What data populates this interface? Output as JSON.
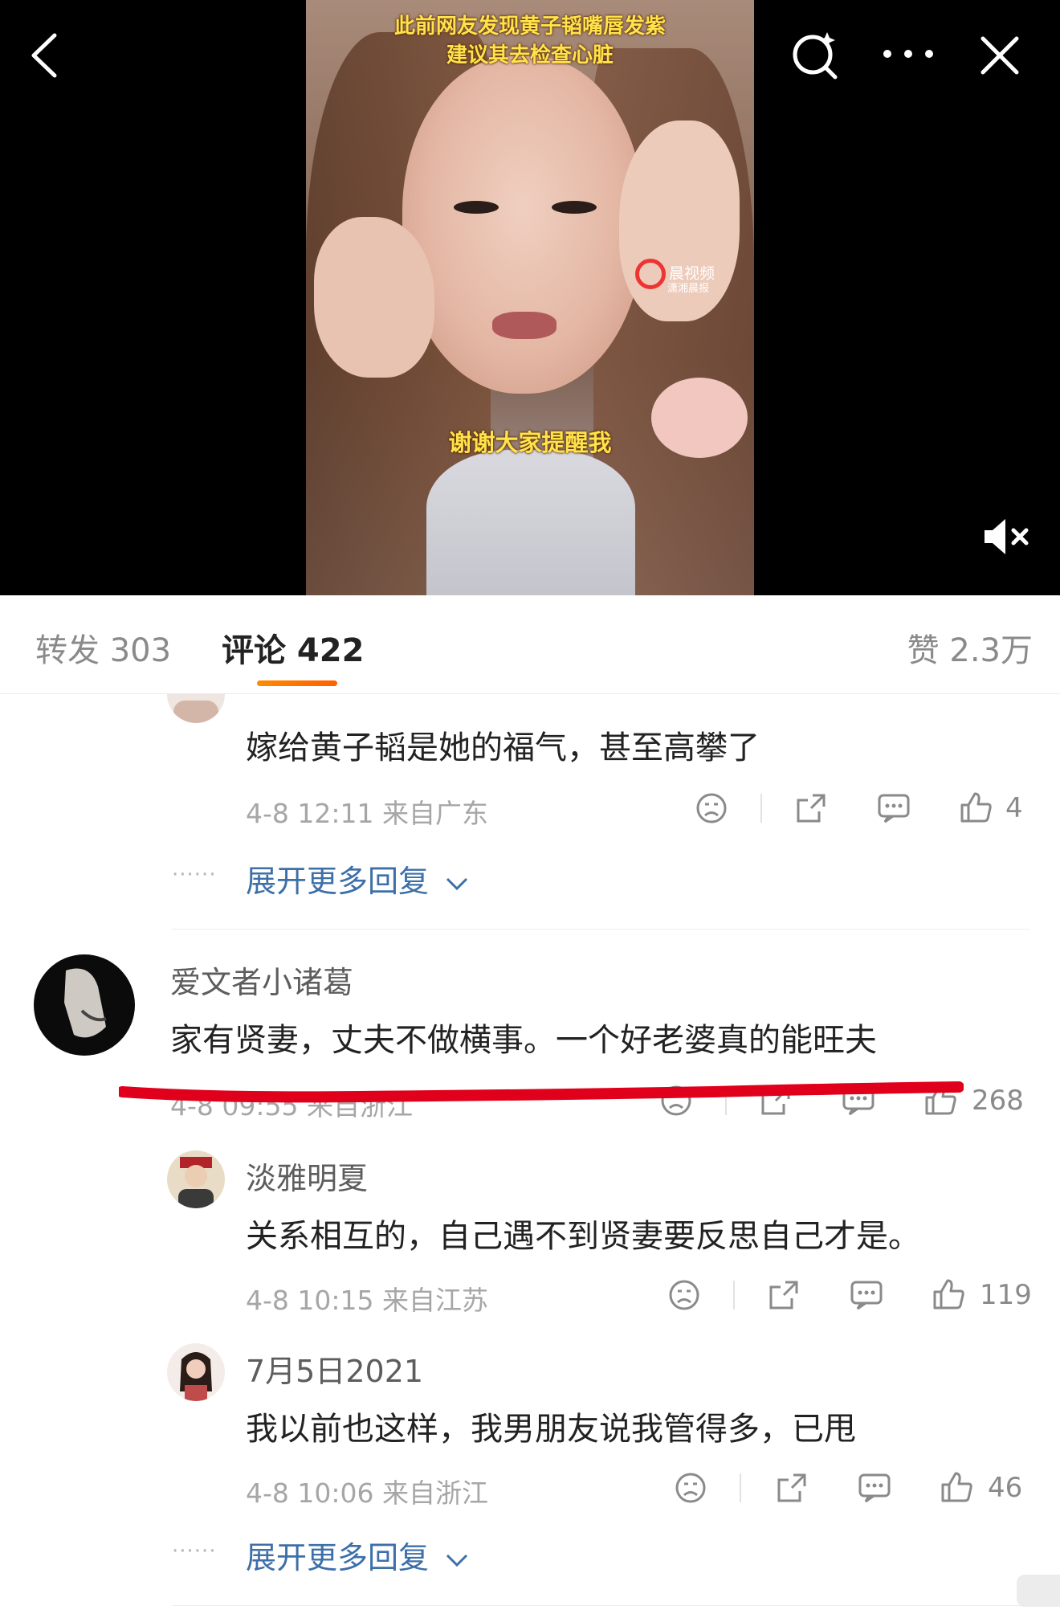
{
  "video": {
    "caption_line1": "此前网友发现黄子韬嘴唇发紫",
    "caption_line2": "建议其去检查心脏",
    "caption_line3": "谢谢大家提醒我",
    "watermark": "晨视频",
    "watermark_sub": "潇湘晨报"
  },
  "tabs": {
    "repost": "转发 303",
    "comment": "评论 422",
    "like": "赞 2.3万"
  },
  "comments": [
    {
      "text": "嫁给黄子韬是她的福气，甚至高攀了",
      "meta": "4-8 12:11 来自广东",
      "likes": "4",
      "expand": "展开更多回复"
    },
    {
      "user": "爱文者小诸葛",
      "text": "家有贤妻，丈夫不做横事。一个好老婆真的能旺夫",
      "meta": "4-8 09:55 来自浙江",
      "likes": "268",
      "replies": [
        {
          "user": "淡雅明夏",
          "text": "关系相互的，自己遇不到贤妻要反思自己才是。",
          "meta": "4-8 10:15 来自江苏",
          "likes": "119"
        },
        {
          "user": "7月5日2021",
          "text": "我以前也这样，我男朋友说我管得多，已甩",
          "meta": "4-8 10:06 来自浙江",
          "likes": "46"
        }
      ],
      "expand": "展开更多回复"
    }
  ],
  "dots": "······",
  "colors": {
    "accent": "#ff6a00",
    "link": "#3d6fa8",
    "redline": "#e0001b"
  }
}
